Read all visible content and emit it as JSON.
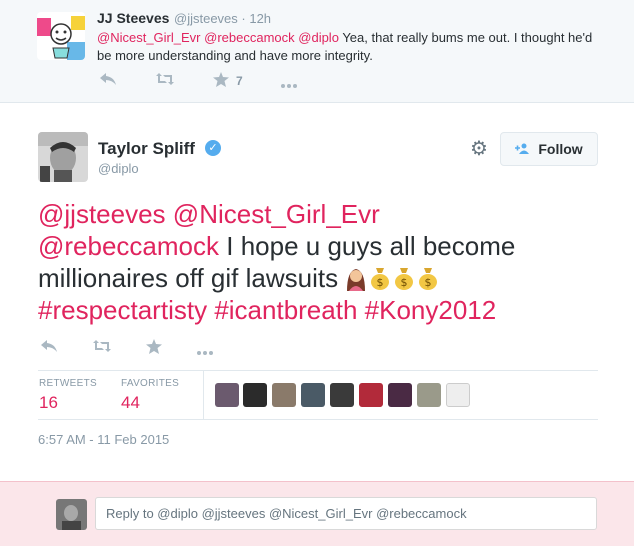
{
  "parent_tweet": {
    "author_name": "JJ Steeves",
    "author_handle": "@jjsteeves",
    "time_ago": "· 12h",
    "mentions": [
      "@Nicest_Girl_Evr",
      "@rebeccamock",
      "@diplo"
    ],
    "text": "Yea, that really bums me out. I thought he'd be more understanding and have more integrity.",
    "favorite_count": "7",
    "icons": [
      "reply-icon",
      "retweet-icon",
      "star-icon",
      "more-icon"
    ]
  },
  "main_tweet": {
    "author_name": "Taylor Spliff",
    "author_handle": "@diplo",
    "follow_label": "Follow",
    "line1_mentions": [
      "@jjsteeves",
      "@Nicest_Girl_Evr"
    ],
    "line2_mention": "@rebeccamock",
    "line2_text": "I hope u guys all become",
    "line3_text": "millionaires off gif lawsuits",
    "emojis": [
      "woman-emoji",
      "money-bag-emoji",
      "money-bag-emoji",
      "money-bag-emoji"
    ],
    "hashtags": [
      "#respectartisty",
      "#icantbreath",
      "#Kony2012"
    ],
    "stats": {
      "retweets_label": "RETWEETS",
      "retweets_value": "16",
      "favorites_label": "FAVORITES",
      "favorites_value": "44"
    },
    "timestamp": "6:57 AM - 11 Feb 2015"
  },
  "reply_box": {
    "placeholder": "Reply to @diplo @jjsteeves @Nicest_Girl_Evr @rebeccamock"
  },
  "colors": {
    "link": "#e0245e",
    "verified": "#55acee",
    "muted": "#8899a6",
    "reply_bg": "#fbe6ea"
  }
}
